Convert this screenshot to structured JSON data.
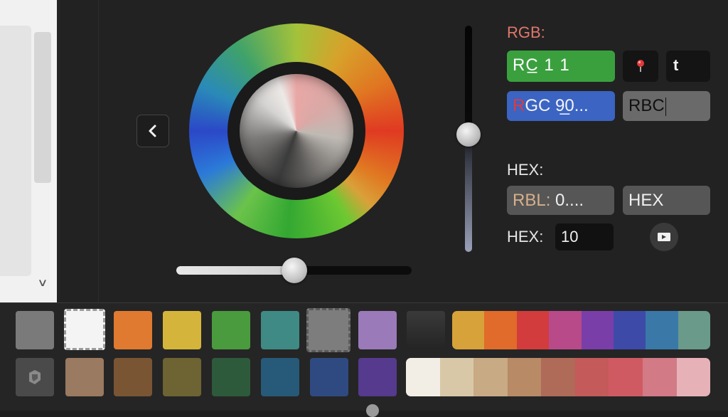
{
  "icons": {
    "back": "chevron-left-icon",
    "chevron_down": "chevron-down-icon",
    "pin": "pin-icon",
    "screen": "screen-icon",
    "eyedropper": "eyedropper-icon"
  },
  "rgb_section": {
    "title": "RGB:",
    "field_green": "RC̲  1  1",
    "field_t": "t",
    "field_blue_prefix": "R",
    "field_blue_rest": "GC 9̲0...",
    "field_rbc": "RBC"
  },
  "hex_section": {
    "title": "HEX:",
    "rbl_key": "RBL:",
    "rbl_value": " 0....",
    "hex_field": "HEX",
    "hex_label": "HEX:",
    "hex_value": "10"
  },
  "swatches_row1": [
    {
      "color": "#7a7a7a",
      "selected": false
    },
    {
      "color": "#f4f4f4",
      "selected": true
    },
    {
      "color": "#e07a30",
      "selected": false
    },
    {
      "color": "#d4b43a",
      "selected": false
    },
    {
      "color": "#4a9a3e",
      "selected": false
    },
    {
      "color": "#3f8a85",
      "selected": false
    },
    {
      "color": "#7d7d7d",
      "selected": false
    },
    {
      "color": "#9a7ab8",
      "selected": false
    },
    {
      "color": "#333333",
      "selected": false
    }
  ],
  "swatches_row2": [
    {
      "color": "#9a7a60"
    },
    {
      "color": "#7a5534"
    },
    {
      "color": "#6e6332"
    },
    {
      "color": "#2e5a3c"
    },
    {
      "color": "#265a78"
    },
    {
      "color": "#2f4a80"
    },
    {
      "color": "#553a8e"
    }
  ],
  "gradient_strip_1": [
    "#d8a23a",
    "#e06b2a",
    "#d23c3c",
    "#b84a8a",
    "#7a3ea8",
    "#3d4aa8",
    "#3a78a8",
    "#6a9a8a"
  ],
  "gradient_strip_2": [
    "#f2eee6",
    "#d8c8a8",
    "#c8aa84",
    "#b88a66",
    "#b06a58",
    "#c45a5a",
    "#d05a62",
    "#d27a86",
    "#e6b2b8"
  ],
  "colors": {
    "rgb_title": "#e0776b",
    "green_field": "#3aa03e",
    "blue_field": "#3b64c3"
  }
}
